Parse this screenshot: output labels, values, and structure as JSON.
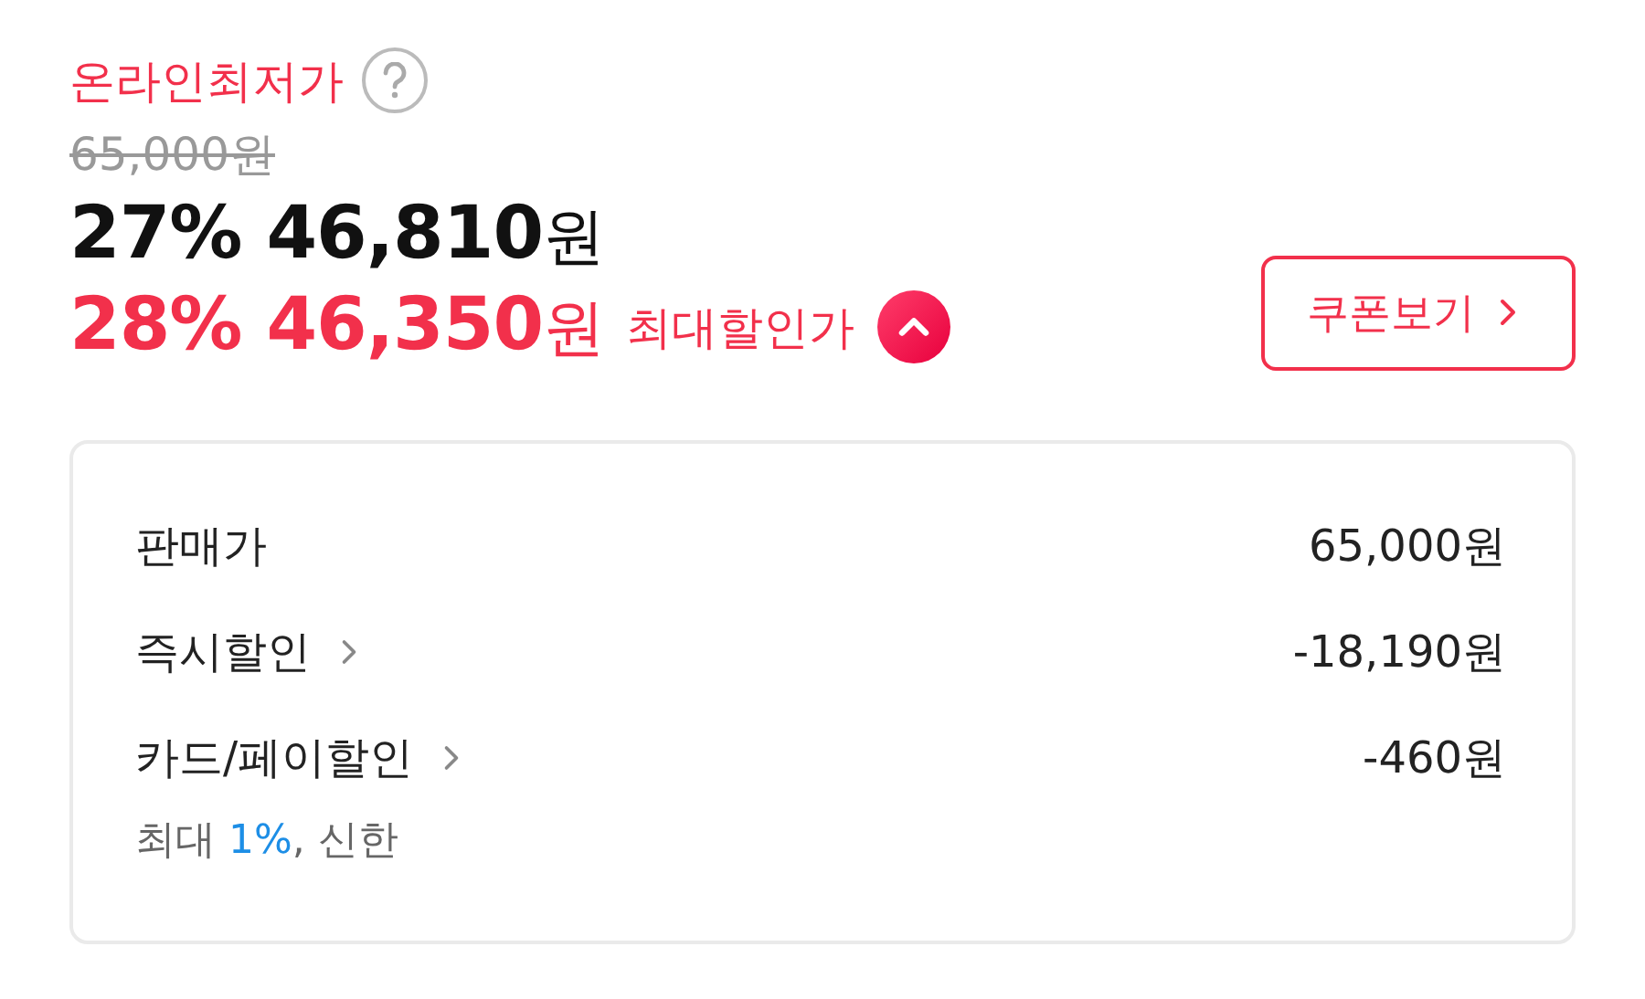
{
  "price_header": {
    "label": "온라인최저가",
    "original_price": "65,000원",
    "original_struck": true
  },
  "prices": [
    {
      "kind": "regular",
      "rate": "27%",
      "amount": "46,810",
      "unit": "원"
    },
    {
      "kind": "best",
      "rate": "28%",
      "amount": "46,350",
      "unit": "원",
      "badge": "최대할인가",
      "expanded": true
    }
  ],
  "coupon_button": {
    "label": "쿠폰보기"
  },
  "breakdown": [
    {
      "label": "판매가",
      "value": "65,000원",
      "link": false
    },
    {
      "label": "즉시할인",
      "value": "-18,190원",
      "link": true
    },
    {
      "label": "카드/페이할인",
      "value": "-460원",
      "link": true,
      "note": {
        "prefix": "최대 ",
        "highlight": "1%",
        "suffix": ", 신한"
      }
    }
  ]
}
